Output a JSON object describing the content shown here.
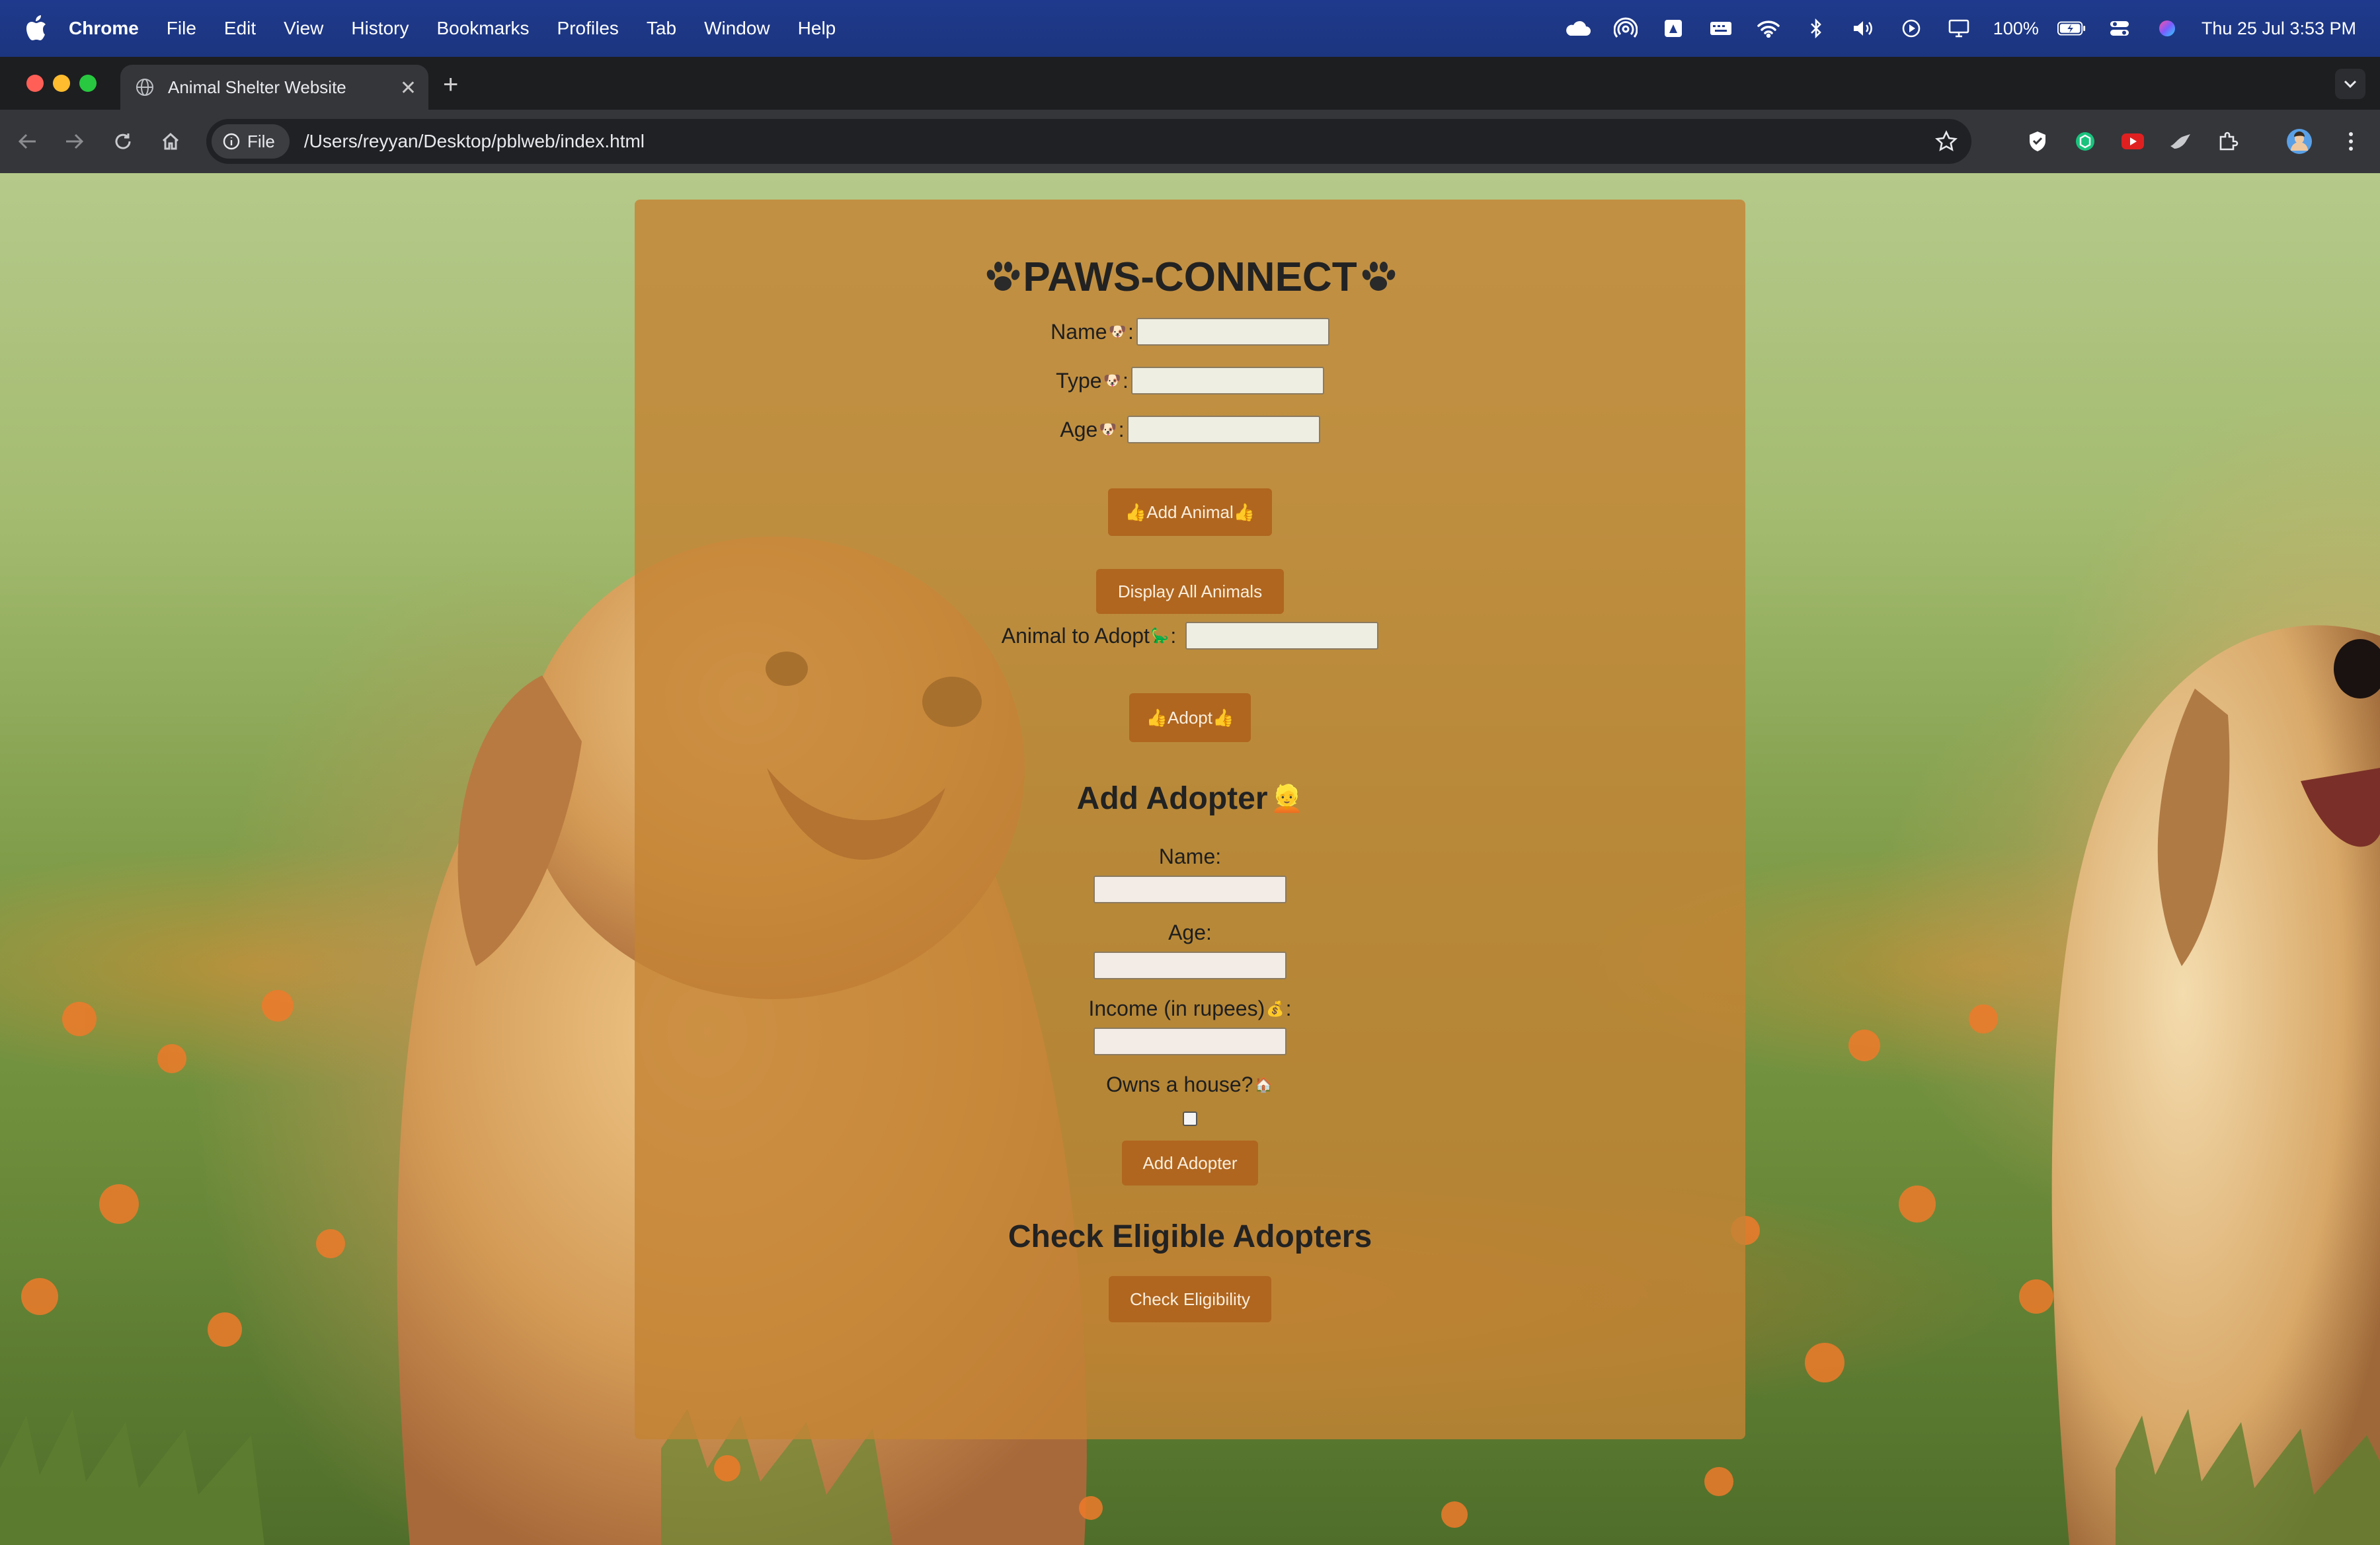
{
  "menubar": {
    "app_name": "Chrome",
    "items": [
      "File",
      "Edit",
      "View",
      "History",
      "Bookmarks",
      "Profiles",
      "Tab",
      "Window",
      "Help"
    ],
    "battery": "100%",
    "datetime": "Thu 25 Jul  3:53 PM"
  },
  "browser": {
    "tab_title": "Animal Shelter Website",
    "url_chip": "File",
    "url": "/Users/reyyan/Desktop/pblweb/index.html"
  },
  "page": {
    "title": "PAWS-CONNECT",
    "animal_form": {
      "name_label": "Name",
      "type_label": "Type",
      "age_label": "Age",
      "label_emoji": "🐶",
      "colon": ":",
      "add_button": "👍Add Animal👍"
    },
    "display_button": "Display All Animals",
    "adopt": {
      "label": "Animal to Adopt",
      "emoji": "🦕",
      "colon": ":",
      "button": "👍Adopt👍"
    },
    "adopter": {
      "heading": "Add Adopter",
      "heading_emoji": "👱",
      "name_label": "Name:",
      "age_label": "Age:",
      "income_label": "Income (in rupees)",
      "income_emoji": "💰",
      "income_colon": ":",
      "house_label": "Owns a house?",
      "house_emoji": "🏠",
      "button": "Add Adopter"
    },
    "eligible": {
      "heading": "Check Eligible Adopters",
      "button": "Check Eligibility"
    }
  },
  "colors": {
    "menubar": "#1f3a8c",
    "panel": "#c48434",
    "button": "#b0661f"
  }
}
